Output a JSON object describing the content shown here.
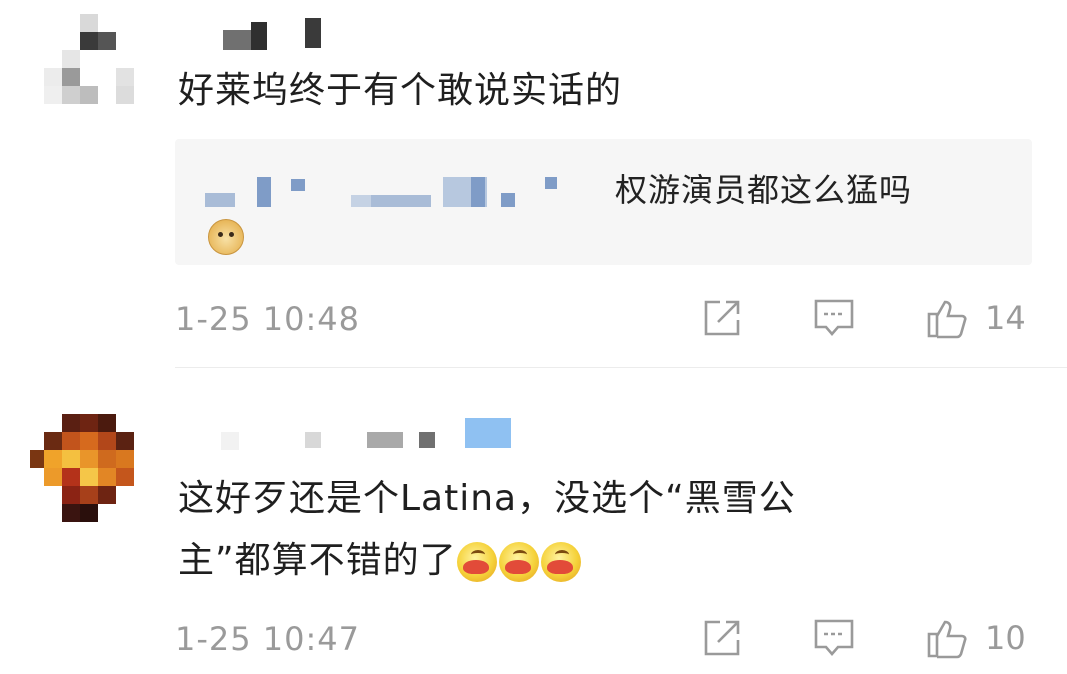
{
  "comments": [
    {
      "text": "好莱坞终于有个敢说实话的",
      "reply": {
        "text": "权游演员都这么猛吗",
        "emoji": "doge"
      },
      "timestamp": "1-25 10:48",
      "likes": "14"
    },
    {
      "text_line1": "这好歹还是个Latina，没选个“黑雪公",
      "text_line2": "主”都算不错的了",
      "emoji": "drooling-emoji",
      "timestamp": "1-25 10:47",
      "likes": "10"
    }
  ],
  "icons": {
    "share": "share-icon",
    "comment": "comment-icon",
    "like": "thumbs-up-icon"
  },
  "colors": {
    "meta_gray": "#9a9a9a",
    "reply_bg": "#f6f6f6",
    "link_blue": "#9ab3d5"
  }
}
